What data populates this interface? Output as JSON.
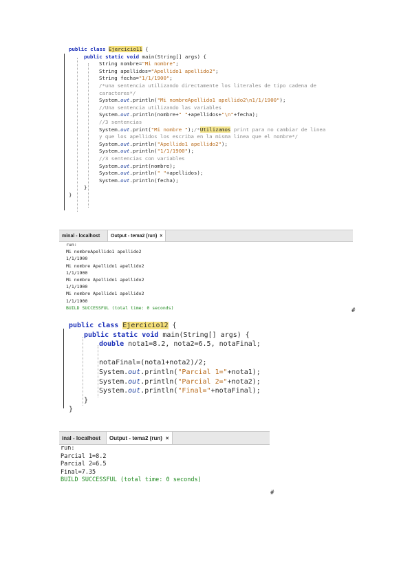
{
  "editor1": {
    "lines": [
      {
        "indent": 0,
        "parts": [
          {
            "t": "public class ",
            "c": "kw"
          },
          {
            "t": "Ejercicio11",
            "c": "hl"
          },
          {
            "t": " {",
            "c": ""
          }
        ]
      },
      {
        "indent": 2,
        "parts": [
          {
            "t": "public static void ",
            "c": "kw"
          },
          {
            "t": "main(String[] args) {",
            "c": ""
          }
        ]
      },
      {
        "indent": 4,
        "parts": [
          {
            "t": "String nombre=",
            "c": ""
          },
          {
            "t": "\"Mi nombre\"",
            "c": "str"
          },
          {
            "t": ";",
            "c": ""
          }
        ]
      },
      {
        "indent": 4,
        "parts": [
          {
            "t": "String apellidos=",
            "c": ""
          },
          {
            "t": "\"Apellido1 apellido2\"",
            "c": "str"
          },
          {
            "t": ";",
            "c": ""
          }
        ]
      },
      {
        "indent": 4,
        "parts": [
          {
            "t": "String fecha=",
            "c": ""
          },
          {
            "t": "\"1/1/1900\"",
            "c": "str"
          },
          {
            "t": ";",
            "c": ""
          }
        ]
      },
      {
        "indent": 4,
        "parts": [
          {
            "t": "/*una sentencia utilizando directamente los literales de tipo cadena de",
            "c": "cm"
          }
        ]
      },
      {
        "indent": 4,
        "parts": [
          {
            "t": "caracteres*/",
            "c": "cm"
          }
        ]
      },
      {
        "indent": 4,
        "parts": [
          {
            "t": "System.",
            "c": ""
          },
          {
            "t": "out",
            "c": "fld"
          },
          {
            "t": ".println(",
            "c": ""
          },
          {
            "t": "\"Mi nombreApellido1 apellido2\\n1/1/1900\"",
            "c": "str"
          },
          {
            "t": ");",
            "c": ""
          }
        ]
      },
      {
        "indent": 4,
        "parts": [
          {
            "t": "//Una sentencia utilizando las variables",
            "c": "cm"
          }
        ]
      },
      {
        "indent": 4,
        "parts": [
          {
            "t": "System.",
            "c": ""
          },
          {
            "t": "out",
            "c": "fld"
          },
          {
            "t": ".println(nombre+",
            "c": ""
          },
          {
            "t": "\" \"",
            "c": "str"
          },
          {
            "t": "+apellidos+",
            "c": ""
          },
          {
            "t": "\"\\n\"",
            "c": "str"
          },
          {
            "t": "+fecha);",
            "c": ""
          }
        ]
      },
      {
        "indent": 4,
        "parts": [
          {
            "t": "//3 sentencias",
            "c": "cm"
          }
        ]
      },
      {
        "indent": 4,
        "parts": [
          {
            "t": "System.",
            "c": ""
          },
          {
            "t": "out",
            "c": "fld"
          },
          {
            "t": ".print(",
            "c": ""
          },
          {
            "t": "\"Mi nombre \"",
            "c": "str"
          },
          {
            "t": ");",
            "c": ""
          },
          {
            "t": "/*",
            "c": "cm"
          },
          {
            "t": "Utilizamos",
            "c": "hl2"
          },
          {
            "t": " print para no cambiar de linea",
            "c": "cm"
          }
        ]
      },
      {
        "indent": 4,
        "parts": [
          {
            "t": "y que los apellidos los escriba en la misma linea que el nombre*/",
            "c": "cm"
          }
        ]
      },
      {
        "indent": 4,
        "parts": [
          {
            "t": "System.",
            "c": ""
          },
          {
            "t": "out",
            "c": "fld"
          },
          {
            "t": ".println(",
            "c": ""
          },
          {
            "t": "\"Apellido1 apellido2\"",
            "c": "str"
          },
          {
            "t": ");",
            "c": ""
          }
        ]
      },
      {
        "indent": 4,
        "parts": [
          {
            "t": "System.",
            "c": ""
          },
          {
            "t": "out",
            "c": "fld"
          },
          {
            "t": ".println(",
            "c": ""
          },
          {
            "t": "\"1/1/1900\"",
            "c": "str"
          },
          {
            "t": ");",
            "c": ""
          }
        ]
      },
      {
        "indent": 4,
        "parts": [
          {
            "t": "//3 sentencias con variables",
            "c": "cm"
          }
        ]
      },
      {
        "indent": 4,
        "parts": [
          {
            "t": "System.",
            "c": ""
          },
          {
            "t": "out",
            "c": "fld"
          },
          {
            "t": ".print(nombre);",
            "c": ""
          }
        ]
      },
      {
        "indent": 4,
        "parts": [
          {
            "t": "System.",
            "c": ""
          },
          {
            "t": "out",
            "c": "fld"
          },
          {
            "t": ".println(",
            "c": ""
          },
          {
            "t": "\" \"",
            "c": "str"
          },
          {
            "t": "+apellidos);",
            "c": ""
          }
        ]
      },
      {
        "indent": 4,
        "parts": [
          {
            "t": "System.",
            "c": ""
          },
          {
            "t": "out",
            "c": "fld"
          },
          {
            "t": ".println(fecha);",
            "c": ""
          }
        ]
      },
      {
        "indent": 2,
        "parts": [
          {
            "t": "}",
            "c": ""
          }
        ]
      },
      {
        "indent": 0,
        "parts": [
          {
            "t": "}",
            "c": ""
          }
        ]
      }
    ]
  },
  "tabs1": {
    "left": "minal - localhost",
    "active": "Output - tema2 (run)",
    "close": "×"
  },
  "output1": {
    "lines": [
      {
        "t": "run:",
        "g": false
      },
      {
        "t": "Mi nombreApellido1 apellido2",
        "g": false
      },
      {
        "t": "1/1/1900",
        "g": false
      },
      {
        "t": "Mi nombre Apellido1 apellido2",
        "g": false
      },
      {
        "t": "1/1/1900",
        "g": false
      },
      {
        "t": "Mi nombre Apellido1 apellido2",
        "g": false
      },
      {
        "t": "1/1/1900",
        "g": false
      },
      {
        "t": "Mi nombre Apellido1 apellido2",
        "g": false
      },
      {
        "t": "1/1/1900",
        "g": false
      },
      {
        "t": "BUILD SUCCESSFUL (total time: 0 seconds)",
        "g": true
      }
    ],
    "hash": "#"
  },
  "editor2": {
    "lines": [
      {
        "indent": 0,
        "parts": [
          {
            "t": "public class ",
            "c": "kw"
          },
          {
            "t": "Ejercicio12",
            "c": "hl"
          },
          {
            "t": " {",
            "c": ""
          }
        ]
      },
      {
        "indent": 2,
        "parts": [
          {
            "t": "public static void ",
            "c": "kw"
          },
          {
            "t": "main(String[] args) {",
            "c": ""
          }
        ]
      },
      {
        "indent": 4,
        "parts": [
          {
            "t": "double ",
            "c": "kw"
          },
          {
            "t": "nota1=8.2, nota2=6.5, notaFinal;",
            "c": ""
          }
        ]
      },
      {
        "indent": 4,
        "parts": [
          {
            "t": "",
            "c": ""
          }
        ]
      },
      {
        "indent": 4,
        "parts": [
          {
            "t": "notaFinal=(nota1+nota2)/2;",
            "c": ""
          }
        ]
      },
      {
        "indent": 4,
        "parts": [
          {
            "t": "System.",
            "c": ""
          },
          {
            "t": "out",
            "c": "fld"
          },
          {
            "t": ".println(",
            "c": ""
          },
          {
            "t": "\"Parcial 1=\"",
            "c": "str"
          },
          {
            "t": "+nota1);",
            "c": ""
          }
        ]
      },
      {
        "indent": 4,
        "parts": [
          {
            "t": "System.",
            "c": ""
          },
          {
            "t": "out",
            "c": "fld"
          },
          {
            "t": ".println(",
            "c": ""
          },
          {
            "t": "\"Parcial 2=\"",
            "c": "str"
          },
          {
            "t": "+nota2);",
            "c": ""
          }
        ]
      },
      {
        "indent": 4,
        "parts": [
          {
            "t": "System.",
            "c": ""
          },
          {
            "t": "out",
            "c": "fld"
          },
          {
            "t": ".println(",
            "c": ""
          },
          {
            "t": "\"Final=\"",
            "c": "str"
          },
          {
            "t": "+notaFinal);",
            "c": ""
          }
        ]
      },
      {
        "indent": 2,
        "parts": [
          {
            "t": "}",
            "c": ""
          }
        ]
      },
      {
        "indent": 0,
        "parts": [
          {
            "t": "}",
            "c": ""
          }
        ]
      }
    ]
  },
  "tabs2": {
    "left": "inal - localhost",
    "active": "Output - tema2 (run)",
    "close": "×"
  },
  "output2": {
    "lines": [
      {
        "t": "run:",
        "g": false
      },
      {
        "t": "Parcial 1=8.2",
        "g": false
      },
      {
        "t": "Parcial 2=6.5",
        "g": false
      },
      {
        "t": "Final=7.35",
        "g": false
      },
      {
        "t": "BUILD SUCCESSFUL (total time: 0 seconds)",
        "g": true
      }
    ],
    "hash": "#"
  }
}
